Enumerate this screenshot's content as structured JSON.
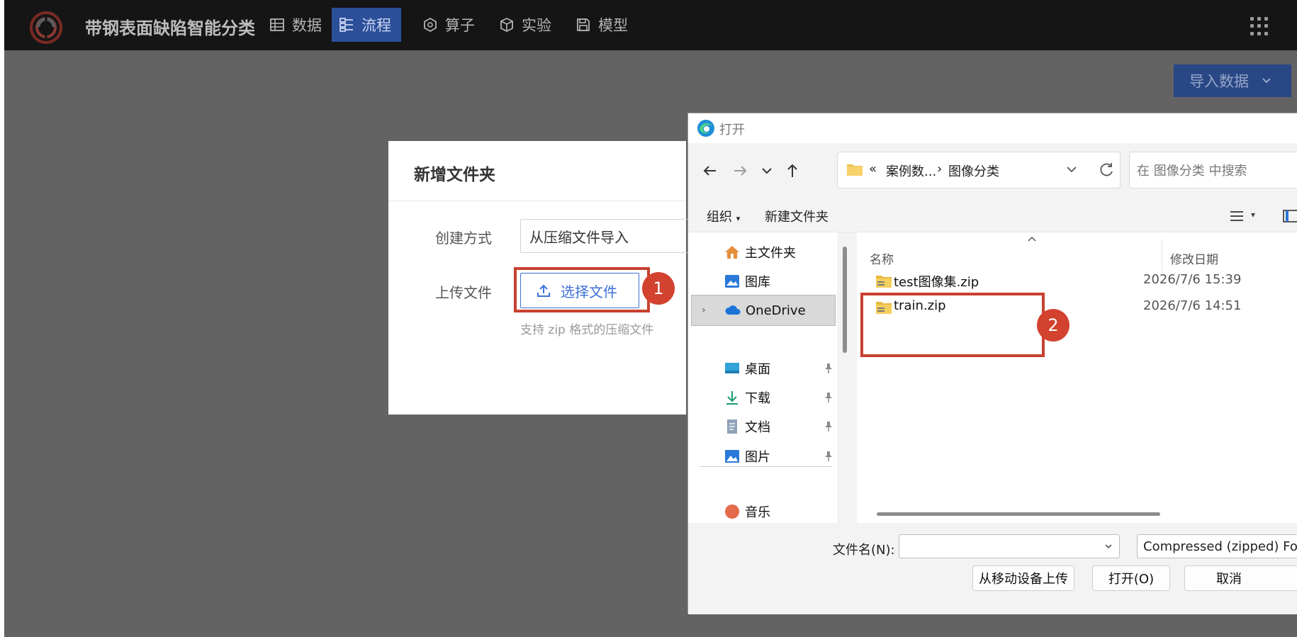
{
  "app": {
    "title": "带钢表面缺陷智能分类",
    "nav": [
      {
        "label": "数据",
        "icon": "table-icon"
      },
      {
        "label": "流程",
        "icon": "flow-icon",
        "active": true
      },
      {
        "label": "算子",
        "icon": "hexagon-icon"
      },
      {
        "label": "实验",
        "icon": "cube-icon"
      },
      {
        "label": "模型",
        "icon": "save-icon"
      }
    ],
    "import_button": "导入数据"
  },
  "new_folder_dialog": {
    "title": "新增文件夹",
    "method_label": "创建方式",
    "method_value": "从压缩文件导入",
    "upload_label": "上传文件",
    "upload_button": "选择文件",
    "hint": "支持 zip 格式的压缩文件"
  },
  "annotations": {
    "badge1": "1",
    "badge2": "2",
    "color": "#c8412f"
  },
  "file_dialog": {
    "title": "打开",
    "address": {
      "prefix": "«",
      "crumb1": "案例数...",
      "sep": "›",
      "crumb2": "图像分类"
    },
    "search_placeholder": "在 图像分类 中搜索",
    "organize": "组织",
    "new_folder": "新建文件夹",
    "nav_items": [
      {
        "label": "主文件夹",
        "icon": "home-icon"
      },
      {
        "label": "图库",
        "icon": "gallery-icon"
      },
      {
        "label": "OneDrive",
        "icon": "cloud-icon"
      },
      {
        "label": "桌面",
        "icon": "desktop-icon"
      },
      {
        "label": "下载",
        "icon": "download-icon"
      },
      {
        "label": "文档",
        "icon": "document-icon"
      },
      {
        "label": "图片",
        "icon": "picture-icon"
      },
      {
        "label": "音乐",
        "icon": "music-icon"
      }
    ],
    "columns": {
      "name": "名称",
      "modified": "修改日期"
    },
    "files": [
      {
        "name": "test图像集.zip",
        "modified": "2026/7/6 15:39"
      },
      {
        "name": "train.zip",
        "modified": "2026/7/6 14:51"
      }
    ],
    "filename_label": "文件名(N):",
    "filename_value": "",
    "file_type": "Compressed (zipped) Folder",
    "btn_mobile": "从移动设备上传",
    "btn_open": "打开(O)",
    "btn_cancel": "取消"
  }
}
